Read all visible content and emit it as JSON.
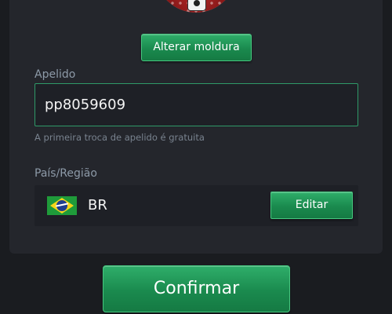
{
  "avatar": {
    "frame_button_label": "Alterar moldura",
    "camera_icon": "camera-icon"
  },
  "nickname": {
    "label": "Apelido",
    "value": "pp8059609",
    "hint": "A primeira troca de apelido é gratuita"
  },
  "country": {
    "label": "País/Região",
    "flag_icon": "brazil-flag-icon",
    "code": "BR",
    "edit_label": "Editar"
  },
  "actions": {
    "confirm_label": "Confirmar"
  },
  "colors": {
    "accent_green": "#1a8a4e",
    "field_border": "#2f9a68",
    "background": "#1a1c20",
    "panel": "#24262c"
  }
}
